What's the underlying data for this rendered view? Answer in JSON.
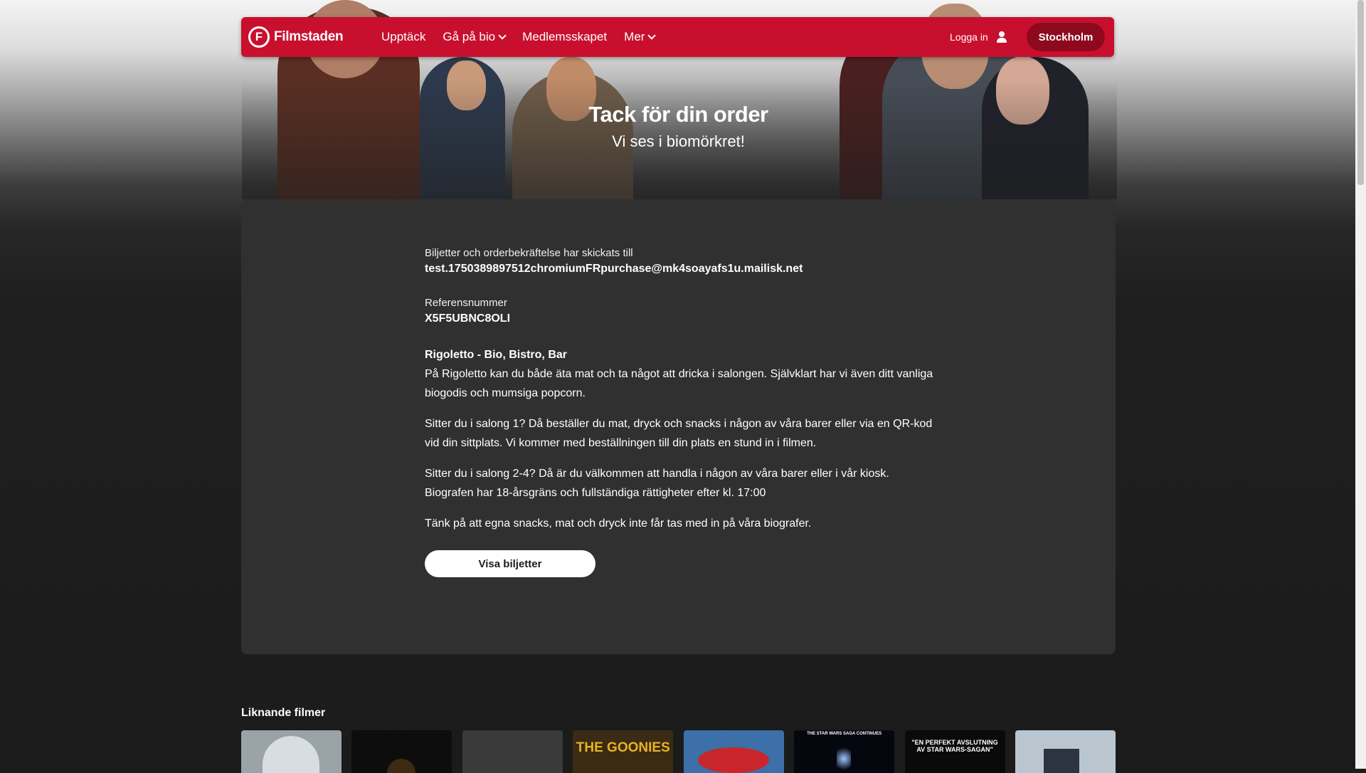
{
  "nav": {
    "logo_text": "Filmstaden",
    "logo_letter": "F",
    "links": [
      {
        "label": "Upptäck",
        "has_dropdown": false
      },
      {
        "label": "Gå på bio",
        "has_dropdown": true
      },
      {
        "label": "Medlemsskapet",
        "has_dropdown": false
      },
      {
        "label": "Mer",
        "has_dropdown": true
      }
    ],
    "login_label": "Logga in",
    "city_label": "Stockholm",
    "brand_color": "#c8102e"
  },
  "hero": {
    "title": "Tack för din order",
    "subtitle": "Vi ses i biomörkret!"
  },
  "order": {
    "sent_label": "Biljetter och orderbekräftelse har skickats till",
    "email": "test.1750389897512chromiumFRpurchase@mk4soayafs1u.mailisk.net",
    "reference_label": "Referensnummer",
    "reference_number": "X5F5UBNC8OLI",
    "venue_title": "Rigoletto - Bio, Bistro, Bar",
    "paragraph_1": "På Rigoletto kan du både äta mat och ta något att dricka i salongen. Självklart har vi även ditt vanliga biogodis och mumsiga popcorn.",
    "paragraph_2": "Sitter du i salong 1? Då beställer du mat, dryck och snacks i någon av våra barer eller via en QR-kod vid din sittplats. Vi kommer med beställningen till din plats en stund in i filmen.",
    "paragraph_3a": "Sitter du i salong 2-4? Då är du välkommen att handla i någon av våra barer eller i vår kiosk.",
    "paragraph_3b": "Biografen har 18-årsgräns och fullständiga rättigheter efter kl. 17:00",
    "paragraph_4": "Tänk på att egna snacks, mat och dryck inte får tas med in på våra biografer.",
    "button_label": "Visa biljetter"
  },
  "similar": {
    "title": "Liknande filmer",
    "posters": [
      {
        "text": "",
        "bg": "#9aa3a8"
      },
      {
        "text": "",
        "bg": "#0d0d0d"
      },
      {
        "text": "",
        "bg": "#3a3a3a"
      },
      {
        "text": "THE GOONIES",
        "bg": "#3b2a14"
      },
      {
        "text": "",
        "bg": "#3d6fa8"
      },
      {
        "text": "THE STAR WARS SAGA CONTINUES",
        "bg": "#05070f"
      },
      {
        "text": "\"EN PERFEKT AVSLUTNING AV STAR WARS-SAGAN\"",
        "bg": "#0a0a0a"
      },
      {
        "text": "",
        "bg": "#b9c6cf"
      }
    ]
  }
}
